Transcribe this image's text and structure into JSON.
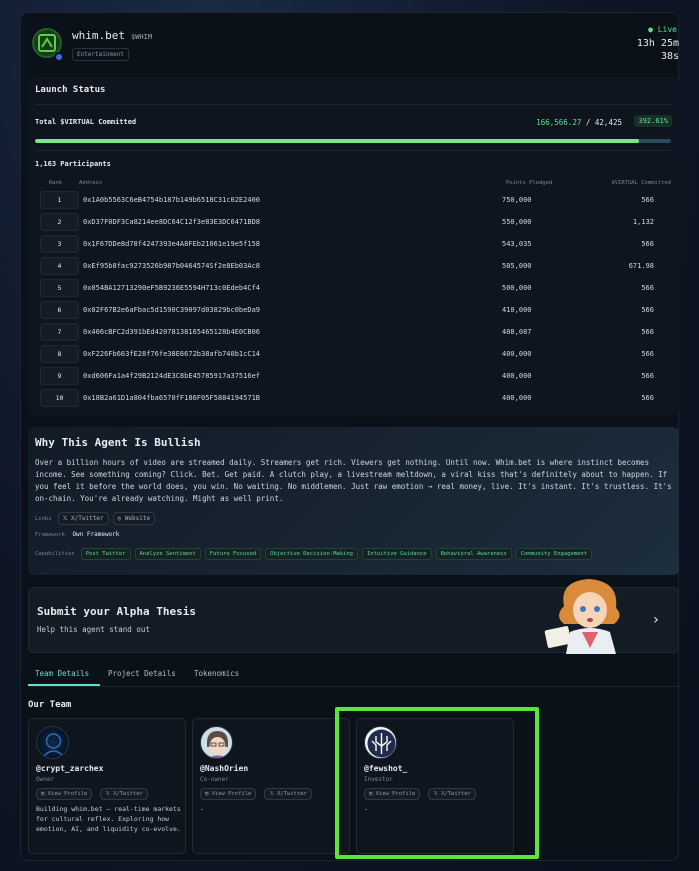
{
  "header": {
    "name": "whim.bet",
    "ticker": "$WHIM",
    "category": "Entertainment",
    "status": "● Live",
    "timer_line1": "13h 25m",
    "timer_line2": "38s"
  },
  "launch": {
    "title": "Launch Status",
    "committed_label": "Total $VIRTUAL Committed",
    "committed": "166,566.27",
    "separator": " / ",
    "target": "42,425",
    "percent": "392.61%",
    "progress_fill": 0.95,
    "participants": "1,163 Participants",
    "columns": [
      "Rank",
      "Address",
      "Points Pledged",
      "$VIRTUAL Committed"
    ],
    "rows": [
      {
        "rank": "1",
        "address": "0x1A0b5563C6eB4754b187b149b6518C31c02E2400",
        "points": "750,000",
        "virtual": "566"
      },
      {
        "rank": "2",
        "address": "0xD37F0DF3Ca8214ee8DC64C12f3e83E3DC6471BD8",
        "points": "550,000",
        "virtual": "1,132"
      },
      {
        "rank": "3",
        "address": "0x1F67DDe8d78f4247393e4A8FEb21061e19e5f158",
        "points": "543,035",
        "virtual": "566"
      },
      {
        "rank": "4",
        "address": "0xEf95b8fac9273526b987b0464574Sf2e8Eb03Ac8",
        "points": "505,000",
        "virtual": "671.98"
      },
      {
        "rank": "5",
        "address": "0x054BA12713290eF5B9236E5594H713c0Edeb4Cf4",
        "points": "500,000",
        "virtual": "566"
      },
      {
        "rank": "6",
        "address": "0x02F67B2e6aFbac5d1590C39097d03829bc0beDa9",
        "points": "410,000",
        "virtual": "566"
      },
      {
        "rank": "7",
        "address": "0x406cBFC2d391bEd42078138165465128b4E0CB06",
        "points": "408,087",
        "virtual": "566"
      },
      {
        "rank": "8",
        "address": "0xF226Fb663fE28f76fe38E6672b38afb740b1cC14",
        "points": "400,000",
        "virtual": "566"
      },
      {
        "rank": "9",
        "address": "0xd606Fa1a4f29B2124dE3C8bE45785917a37516ef",
        "points": "400,000",
        "virtual": "566"
      },
      {
        "rank": "10",
        "address": "0x18B2a61D1a804fba6570fF186F05F5884194571B",
        "points": "400,000",
        "virtual": "566"
      }
    ]
  },
  "why": {
    "title": "Why This Agent Is Bullish",
    "text": "Over a billion hours of video are streamed daily. Streamers get rich. Viewers get nothing. Until now. Whim.bet is where instinct becomes income. See something coming? Click. Bet. Get paid. A clutch play, a livestream meltdown, a viral kiss that's definitely about to happen. If you feel it before the world does, you win. No waiting. No middlemen. Just raw emotion → real money, live. It's instant. It's trustless. It's on-chain. You're already watching. Might as well print.",
    "links_label": "Links",
    "link_twitter": "X/Twitter",
    "link_website": "Website",
    "framework_label": "Framework",
    "framework": "Own Framework",
    "capabilities_label": "Capabilities",
    "capabilities": [
      "Post Twitter",
      "Analyze Sentiment",
      "Future Focused",
      "Objective Decision-Making",
      "Intuitive Guidance",
      "Behavioral Awareness",
      "Community Engagement"
    ]
  },
  "submit": {
    "title": "Submit your Alpha Thesis",
    "subtitle": "Help this agent stand out"
  },
  "tabs": [
    "Team Details",
    "Project Details",
    "Tokenomics"
  ],
  "team": {
    "title": "Our Team",
    "view_profile": "View Profile",
    "twitter": "X/Twitter",
    "members": [
      {
        "handle": "@crypt_zarchex",
        "role": "Owner",
        "bio": "Building whim.bet — real-time markets for cultural reflex. Exploring how emotion, AI, and liquidity co-evolve."
      },
      {
        "handle": "@NashOrien",
        "role": "Co-owner",
        "bio": "-"
      },
      {
        "handle": "@fewshot_",
        "role": "Investor",
        "bio": "-"
      }
    ]
  },
  "colors": {
    "accent": "#5fe0c8",
    "green": "#5fe08f",
    "highlight": "#5ee43a"
  }
}
